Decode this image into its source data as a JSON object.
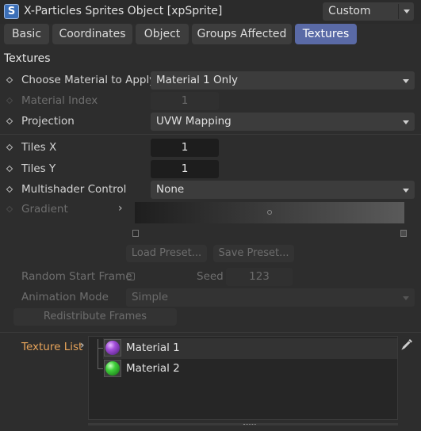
{
  "header": {
    "icon_letter": "S",
    "title": "X-Particles Sprites Object [xpSprite]",
    "mode_value": "Custom"
  },
  "tabs": [
    {
      "label": "Basic",
      "active": false
    },
    {
      "label": "Coordinates",
      "active": false
    },
    {
      "label": "Object",
      "active": false
    },
    {
      "label": "Groups Affected",
      "active": false
    },
    {
      "label": "Textures",
      "active": true
    }
  ],
  "section_title": "Textures",
  "fields": {
    "choose_material": {
      "label": "Choose Material to Apply",
      "value": "Material 1 Only"
    },
    "material_index": {
      "label": "Material Index",
      "value": "1"
    },
    "projection": {
      "label": "Projection",
      "value": "UVW Mapping"
    },
    "tiles_x": {
      "label": "Tiles X",
      "value": "1"
    },
    "tiles_y": {
      "label": "Tiles Y",
      "value": "1"
    },
    "multishader": {
      "label": "Multishader Control",
      "value": "None"
    },
    "gradient": {
      "label": "Gradient"
    },
    "load_preset": "Load Preset...",
    "save_preset": "Save Preset...",
    "random_start_frame": {
      "label": "Random Start Frame",
      "checked": false
    },
    "seed": {
      "label": "Seed",
      "value": "123"
    },
    "animation_mode": {
      "label": "Animation Mode",
      "value": "Simple"
    },
    "redistribute": "Redistribute Frames"
  },
  "texture_list": {
    "label": "Texture List",
    "items": [
      {
        "name": "Material 1",
        "color": "#a24ed8",
        "selected": true
      },
      {
        "name": "Material 2",
        "color": "#3fcf3a",
        "selected": false
      }
    ]
  },
  "colors": {
    "background": "#2d2d2d",
    "active_tab": "#5a6aa6",
    "texture_list_label": "#e8a45a"
  }
}
